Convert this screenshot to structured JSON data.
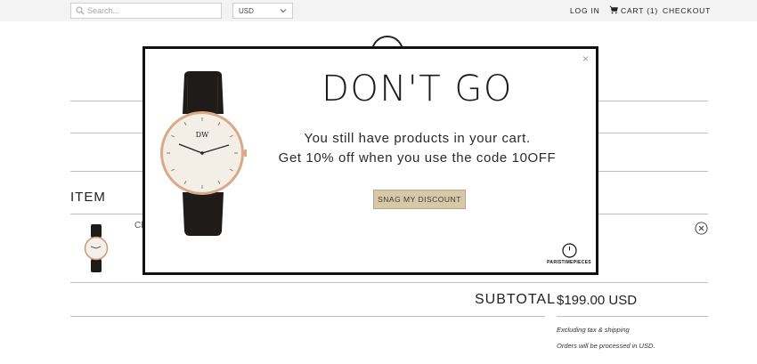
{
  "topbar": {
    "search_placeholder": "Search...",
    "currency": "USD",
    "login": "LOG IN",
    "cart": "CART (1)",
    "checkout": "CHECKOUT"
  },
  "cart_page": {
    "item_heading": "ITEM",
    "item_name_fragment": "Cl",
    "subtotal_label": "SUBTOTAL",
    "subtotal_value": "$199.00 USD",
    "note_tax": "Excluding tax & shipping",
    "note_currency": "Orders will be processed in USD."
  },
  "modal": {
    "close": "×",
    "title": "DON'T GO",
    "line1": "You still have products in your cart.",
    "line2": "Get 10% off when you use the code 10OFF",
    "button": "SNAG MY DISCOUNT",
    "brand": "PARISTIMEPIECES",
    "watch_brand": "DW"
  },
  "colors": {
    "topbar_bg": "#f3f3f3",
    "button_bg": "#d7c9a7",
    "modal_border": "#111111"
  },
  "icons": {
    "search": "search-icon",
    "cart": "cart-icon",
    "remove": "remove-icon",
    "close": "close-icon",
    "chevron": "chevron-down-icon"
  }
}
